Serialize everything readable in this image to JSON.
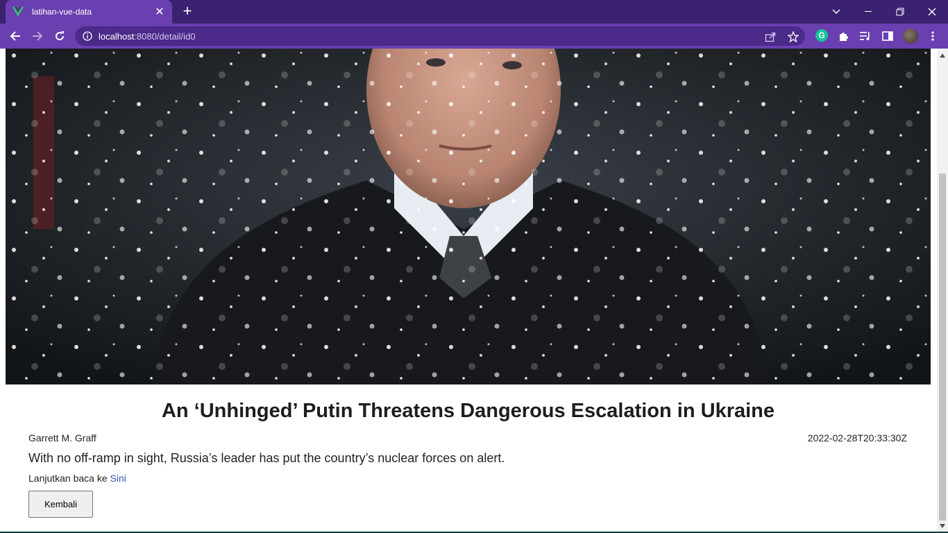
{
  "browser": {
    "tab_title": "latihan-vue-data",
    "url_host": "localhost",
    "url_rest": ":8080/detail/id0",
    "theme_color": "#6a3fb0",
    "favicon": "vue-logo-icon"
  },
  "article": {
    "image_alt": "Vladimir Putin standing in falling snow",
    "title": "An ‘Unhinged’ Putin Threatens Dangerous Escalation in Ukraine",
    "author": "Garrett M. Graff",
    "published_at": "2022-02-28T20:33:30Z",
    "description": "With no off-ramp in sight, Russia’s leader has put the country’s nuclear forces on alert.",
    "readmore_prefix": "Lanjutkan baca ke ",
    "readmore_link": "Sini",
    "back_label": "Kembali"
  }
}
